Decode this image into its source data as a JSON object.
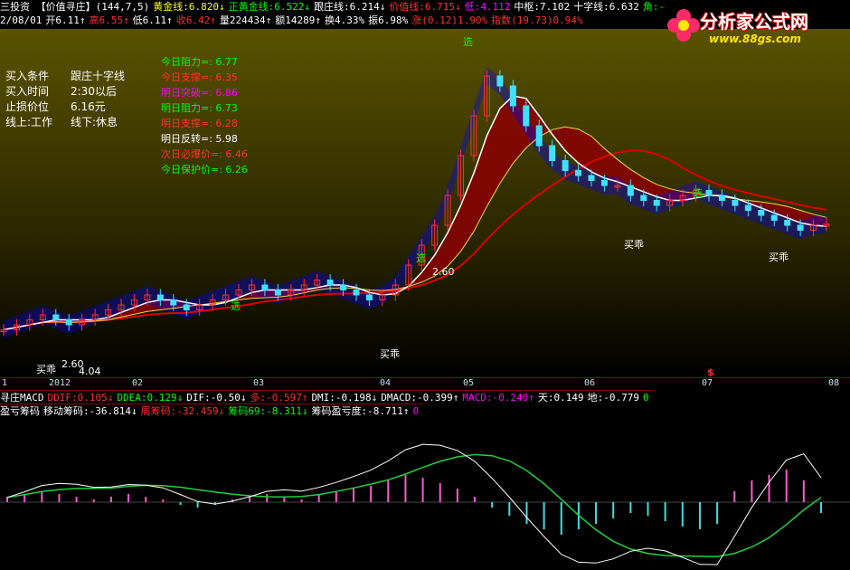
{
  "header": {
    "row1": [
      {
        "t": "三投资 【价值寻庄】(144,7,5)",
        "c": "#ffffff"
      },
      {
        "t": "黄金线:6.820↓",
        "c": "#ffff00"
      },
      {
        "t": "正黄金线:6.522↓",
        "c": "#00ff00"
      },
      {
        "t": "跟庄线:6.214↓",
        "c": "#ffffff"
      },
      {
        "t": "价值线:6.715↓",
        "c": "#ff3030"
      },
      {
        "t": "低:4.112",
        "c": "#ff00ff"
      },
      {
        "t": "中枢:7.102",
        "c": "#ffffff"
      },
      {
        "t": "十字线:6.632",
        "c": "#ffffff"
      },
      {
        "t": "角:-",
        "c": "#00ff00"
      }
    ],
    "row2": [
      {
        "t": "2/08/01",
        "c": "#ffffff"
      },
      {
        "t": "开6.11↑",
        "c": "#ffffff"
      },
      {
        "t": "高6.55↑",
        "c": "#ff3030"
      },
      {
        "t": "低6.11↑",
        "c": "#ffffff"
      },
      {
        "t": "收6.42↑",
        "c": "#ff3030"
      },
      {
        "t": "量224434↑",
        "c": "#ffffff"
      },
      {
        "t": "额14289↑",
        "c": "#ffffff"
      },
      {
        "t": "换4.33%",
        "c": "#ffffff"
      },
      {
        "t": "振6.98%",
        "c": "#ffffff"
      },
      {
        "t": "涨(0.12)1.90%",
        "c": "#ff3030"
      },
      {
        "t": "指数(19.73)0.94%",
        "c": "#ff3030"
      }
    ]
  },
  "logo": {
    "title": "分析家公式网",
    "url": "www.88gs.com"
  },
  "conditions": [
    {
      "label": "买入条件",
      "value": "跟庄十字线"
    },
    {
      "label": "买入时间",
      "value": "2:30以后"
    },
    {
      "label": "止损价位",
      "value": "6.16元"
    },
    {
      "label": "线上:工作",
      "value": "线下:休息"
    }
  ],
  "levels": [
    {
      "t": "今日阻力=: 6.77",
      "c": "#00ff00"
    },
    {
      "t": "今日支撑=: 6.35",
      "c": "#ff3030"
    },
    {
      "t": "明日突破=: 6.86",
      "c": "#ff00ff"
    },
    {
      "t": "明日阻力=: 6.73",
      "c": "#00ff00"
    },
    {
      "t": "明日支撑=: 6.28",
      "c": "#ff3030"
    },
    {
      "t": "明日反转=: 5.98",
      "c": "#ffffff"
    },
    {
      "t": "次日必爆价=: 6.46",
      "c": "#ff3030"
    },
    {
      "t": "今日保护价=: 6.26",
      "c": "#00ff00"
    }
  ],
  "xaxis": [
    "1",
    "2012",
    "02",
    "03",
    "04",
    "05",
    "06",
    "07",
    "08"
  ],
  "indicator_rows": {
    "row1": [
      {
        "t": "寻庄MACD",
        "c": "#ffffff"
      },
      {
        "t": "DDIF:0.105↓",
        "c": "#ff3030"
      },
      {
        "t": "DDEA:0.129↓",
        "c": "#00ff00"
      },
      {
        "t": "DIF:-0.50↓",
        "c": "#ffffff"
      },
      {
        "t": "多:-0.597↑",
        "c": "#ff3030"
      },
      {
        "t": "DMI:-0.198↓",
        "c": "#ffffff"
      },
      {
        "t": "DMACD:-0.399↑",
        "c": "#ffffff"
      },
      {
        "t": "MACD:-0.240↑",
        "c": "#ff00ff"
      },
      {
        "t": "天:0.149",
        "c": "#ffffff"
      },
      {
        "t": "地:-0.779",
        "c": "#ffffff"
      },
      {
        "t": "0",
        "c": "#00ff00"
      }
    ],
    "row2": [
      {
        "t": "盈亏筹码",
        "c": "#ffffff"
      },
      {
        "t": "移动筹码:-36.814↓",
        "c": "#ffffff"
      },
      {
        "t": "周筹码:-32.459↓",
        "c": "#ff3030"
      },
      {
        "t": "筹码69:-8.311↓",
        "c": "#00ff00"
      },
      {
        "t": "筹码盈亏度:-8.711↑",
        "c": "#ffffff"
      },
      {
        "t": "0",
        "c": "#ff00ff"
      }
    ]
  },
  "markers": {
    "xuan": "选",
    "maiguai": "买乖",
    "labels_v": [
      "2.60",
      "4.04",
      "2.60"
    ],
    "dollar": "$"
  },
  "colors": {
    "up_candle": "#ff3030",
    "down_candle": "#40e0ff",
    "value_band": "#8b0000",
    "ma_red": "#dd0000",
    "ma_white": "#ffffff",
    "ma_yellow": "#e8e040",
    "blue_band": "#0000ff",
    "bg_top": "#5a5200"
  },
  "chart_data": {
    "type": "line",
    "months": [
      "12",
      "2012-01",
      "02",
      "03",
      "04",
      "05",
      "06",
      "07",
      "08"
    ],
    "price_close_approx": [
      4.3,
      4.4,
      4.5,
      4.6,
      4.5,
      4.4,
      4.5,
      4.6,
      4.7,
      4.8,
      4.9,
      5.0,
      4.9,
      4.8,
      4.7,
      4.8,
      4.9,
      5.0,
      5.1,
      5.2,
      5.1,
      5.0,
      5.1,
      5.2,
      5.3,
      5.2,
      5.1,
      5.0,
      4.9,
      5.0,
      5.2,
      5.6,
      6.0,
      6.4,
      7.0,
      7.8,
      8.6,
      9.4,
      9.2,
      8.8,
      8.4,
      8.0,
      7.7,
      7.5,
      7.4,
      7.3,
      7.2,
      7.2,
      7.0,
      6.9,
      6.8,
      6.9,
      7.0,
      7.1,
      7.0,
      6.9,
      6.8,
      6.7,
      6.6,
      6.5,
      6.4,
      6.3,
      6.4,
      6.42
    ],
    "macd_hist": [
      0.02,
      0.03,
      0.04,
      0.03,
      0.02,
      0.01,
      0.02,
      0.03,
      0.02,
      0.01,
      -0.01,
      -0.02,
      -0.01,
      0.01,
      0.02,
      0.03,
      0.02,
      0.01,
      0.03,
      0.04,
      0.05,
      0.06,
      0.08,
      0.1,
      0.09,
      0.07,
      0.05,
      0.02,
      -0.02,
      -0.05,
      -0.08,
      -0.1,
      -0.12,
      -0.1,
      -0.08,
      -0.06,
      -0.04,
      -0.05,
      -0.07,
      -0.09,
      -0.1,
      -0.08,
      0.04,
      0.08,
      0.1,
      0.12,
      0.08,
      -0.04
    ],
    "indicator_baseline": 0
  }
}
